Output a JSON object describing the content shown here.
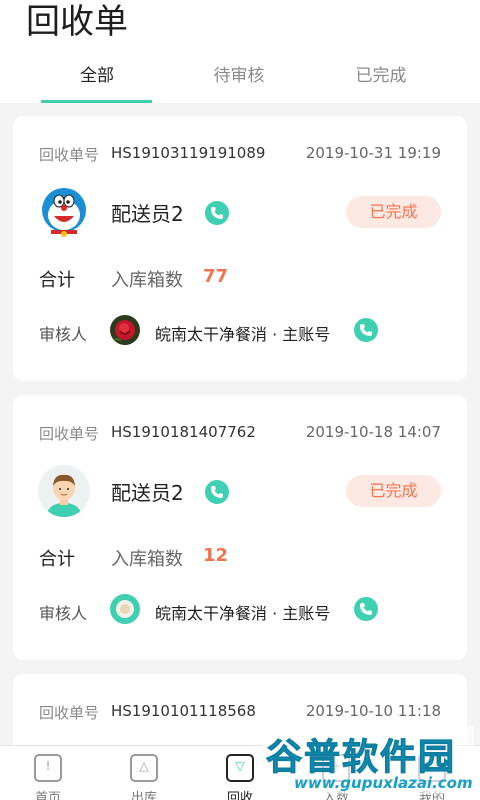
{
  "header": {
    "title": "回收单",
    "tabs": [
      {
        "label": "全部",
        "active": true
      },
      {
        "label": "待审核",
        "active": false
      },
      {
        "label": "已完成",
        "active": false
      }
    ]
  },
  "orders": [
    {
      "order_label": "回收单号",
      "order_no": "HS19103119191089",
      "time": "2019-10-31 19:19",
      "driver_name": "配送员2",
      "status": "已完成",
      "total_label": "合计",
      "boxes_label": "入库箱数",
      "boxes_value": "77",
      "reviewer_label": "审核人",
      "reviewer_name": "皖南太干净餐消 · 主账号"
    },
    {
      "order_label": "回收单号",
      "order_no": "HS1910181407762",
      "time": "2019-10-18 14:07",
      "driver_name": "配送员2",
      "status": "已完成",
      "total_label": "合计",
      "boxes_label": "入库箱数",
      "boxes_value": "12",
      "reviewer_label": "审核人",
      "reviewer_name": "皖南太干净餐消 · 主账号"
    },
    {
      "order_label": "回收单号",
      "order_no": "HS1910101118568",
      "time": "2019-10-10 11:18"
    }
  ],
  "nav": [
    {
      "label": "首页",
      "icon": "home-icon",
      "active": false
    },
    {
      "label": "出库",
      "icon": "outbound-icon",
      "active": false
    },
    {
      "label": "回收",
      "icon": "recycle-icon",
      "active": true
    },
    {
      "label": "入数",
      "icon": "inbound-icon",
      "active": false
    },
    {
      "label": "我的",
      "icon": "profile-icon",
      "active": false
    }
  ],
  "watermark": {
    "title": "谷普软件园",
    "url": "www.gupuxlazai.com"
  },
  "colors": {
    "accent": "#3ed0b1",
    "status": "#f2744e",
    "status_bg": "#fde9e3"
  }
}
